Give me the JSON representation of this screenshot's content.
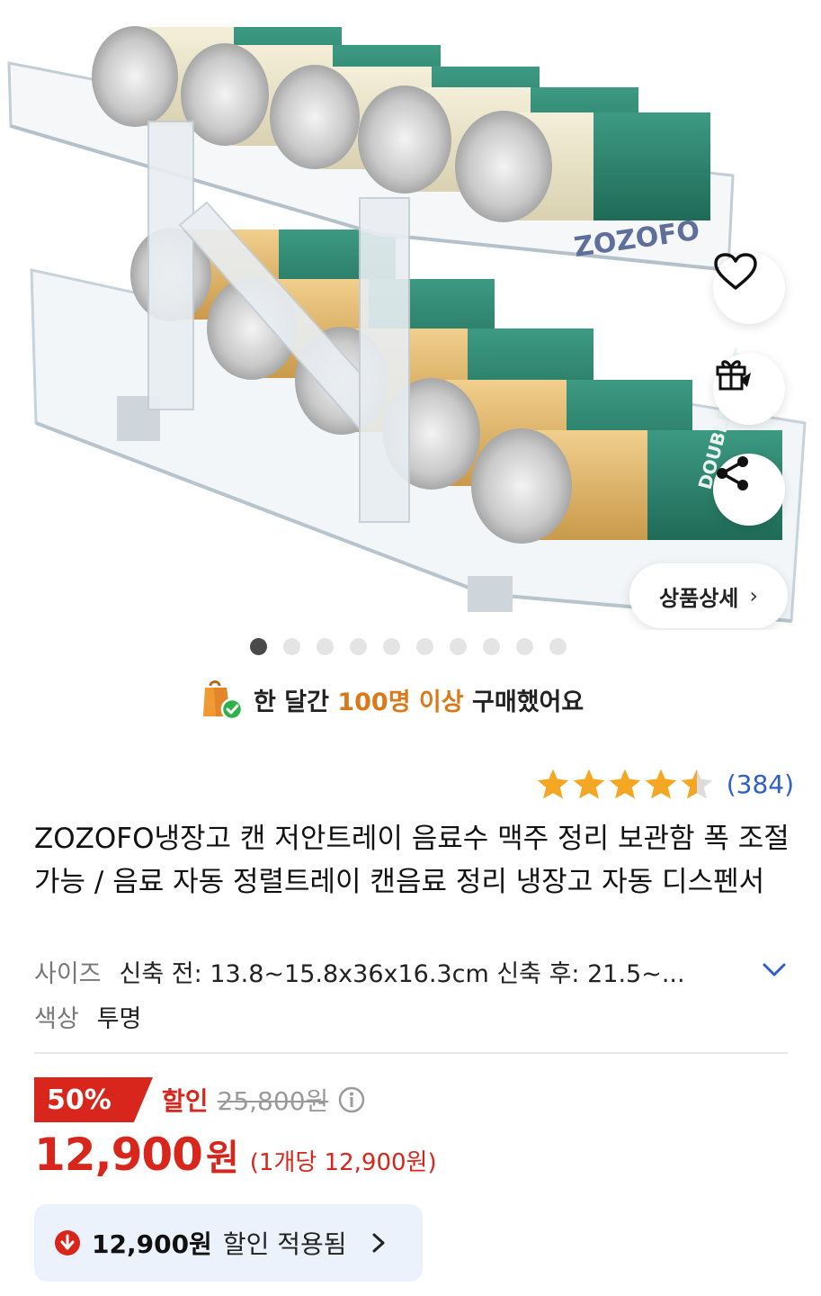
{
  "product_image": {
    "brand_mark": "ZOZOFO",
    "can_text": "DOUBLE SHOT"
  },
  "actions": {
    "wishlist_icon": "heart-icon",
    "gift_icon": "gift-icon",
    "share_icon": "share-icon",
    "detail_label": "상품상세",
    "detail_chevron": "›"
  },
  "carousel": {
    "total": 10,
    "active_index": 0
  },
  "social_proof": {
    "icon": "shopping-bag-check-icon",
    "prefix": "한 달간 ",
    "highlight": "100명 이상",
    "suffix": " 구매했어요"
  },
  "rating": {
    "stars": 4.5,
    "count": "(384)"
  },
  "product": {
    "title": "ZOZOFO냉장고 캔 저안트레이 음료수 맥주 정리 보관함 폭 조절 가능 / 음료 자동 정렬트레이 캔음료 정리 냉장고 자동 디스펜서"
  },
  "options": {
    "size_label": "사이즈",
    "size_value": "신축 전: 13.8~15.8x36x16.3cm 신축 후: 21.5~...",
    "color_label": "색상",
    "color_value": "투명"
  },
  "price": {
    "discount_rate": "50%",
    "discount_word": "할인",
    "original": "25,800원",
    "sale_amount": "12,900",
    "sale_currency": "원",
    "unit_price": "(1개당 12,900원)"
  },
  "coupon": {
    "amount": "12,900원",
    "text": "할인 적용됨"
  },
  "colors": {
    "accent_red": "#d8261c",
    "star": "#f5a623",
    "rating_blue": "#2e5fc9",
    "highlight_orange": "#d9791a",
    "coupon_bg": "#ecf2fc"
  }
}
